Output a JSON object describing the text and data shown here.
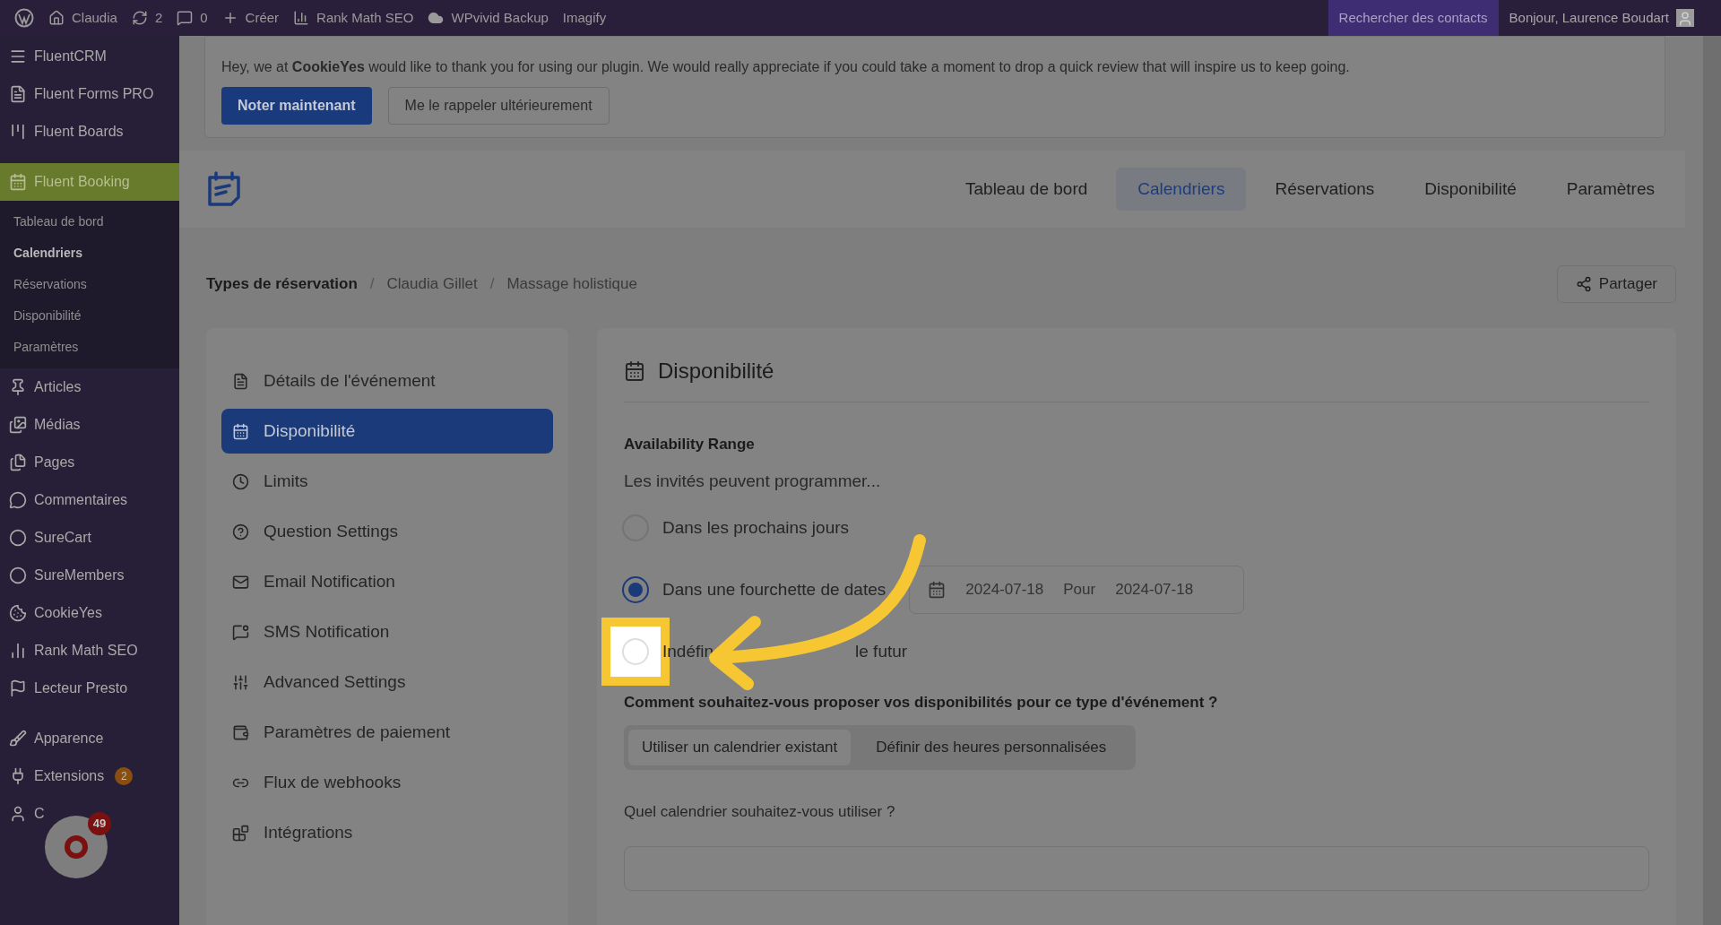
{
  "admin_bar": {
    "left": [
      {
        "kind": "wp"
      },
      {
        "kind": "home",
        "label": "Claudia"
      },
      {
        "kind": "updates",
        "label": "2"
      },
      {
        "kind": "comments",
        "label": "0"
      },
      {
        "kind": "new",
        "label": "Créer"
      },
      {
        "kind": "rankmath",
        "label": "Rank Math SEO"
      },
      {
        "kind": "cloud",
        "label": "WPvivid Backup"
      },
      {
        "kind": "text",
        "label": "Imagify"
      }
    ],
    "search": "Rechercher des contacts",
    "greeting": "Bonjour, Laurence Boudart"
  },
  "sidebar": {
    "items": [
      {
        "label": "FluentCRM",
        "selected": false
      },
      {
        "label": "Fluent Forms PRO",
        "selected": false
      },
      {
        "label": "Fluent Boards",
        "selected": false
      },
      {
        "label": "Fluent Booking",
        "selected": true,
        "children": [
          {
            "label": "Tableau de bord",
            "selected": false
          },
          {
            "label": "Calendriers",
            "selected": true
          },
          {
            "label": "Réservations",
            "selected": false
          },
          {
            "label": "Disponibilité",
            "selected": false
          },
          {
            "label": "Paramètres",
            "selected": false
          }
        ]
      },
      {
        "label": "Articles",
        "selected": false
      },
      {
        "label": "Médias",
        "selected": false
      },
      {
        "label": "Pages",
        "selected": false
      },
      {
        "label": "Commentaires",
        "selected": false
      },
      {
        "label": "SureCart",
        "selected": false
      },
      {
        "label": "SureMembers",
        "selected": false
      },
      {
        "label": "CookieYes",
        "selected": false
      },
      {
        "label": "Rank Math SEO",
        "selected": false
      },
      {
        "label": "Lecteur Presto",
        "selected": false
      },
      {
        "label": "Apparence",
        "selected": false
      },
      {
        "label": "Extensions",
        "selected": false,
        "badge": "2"
      },
      {
        "label": "C",
        "selected": false
      }
    ],
    "widget_badge": "49"
  },
  "notice": {
    "text": "Hey, we at **CookieYes** would like to thank you for using our plugin. We would really appreciate if you could take a moment to drop a quick review that will inspire us to keep going.",
    "buttons": [
      "Noter maintenant",
      "Me le rappeler ultérieurement"
    ]
  },
  "nav": {
    "tabs": [
      {
        "label": "Tableau de bord",
        "selected": false
      },
      {
        "label": "Calendriers",
        "selected": true
      },
      {
        "label": "Réservations",
        "selected": false
      },
      {
        "label": "Disponibilité",
        "selected": false
      },
      {
        "label": "Paramètres",
        "selected": false
      }
    ]
  },
  "breadcrumb": [
    {
      "kind": "link",
      "label": "Types de réservation"
    },
    {
      "kind": "separator",
      "label": "/"
    },
    {
      "kind": "link",
      "label": "Claudia Gillet"
    },
    {
      "kind": "separator",
      "label": "/"
    },
    {
      "kind": "link",
      "label": "Massage holistique"
    }
  ],
  "share_button": "Partager",
  "settings_menu": [
    {
      "label": "Détails de l'événement",
      "selected": false
    },
    {
      "label": "Disponibilité",
      "selected": true
    },
    {
      "label": "Limits",
      "selected": false
    },
    {
      "label": "Question Settings",
      "selected": false
    },
    {
      "label": "Email Notification",
      "selected": false
    },
    {
      "label": "SMS Notification",
      "selected": false
    },
    {
      "label": "Advanced Settings",
      "selected": false
    },
    {
      "label": "Paramètres de paiement",
      "selected": false
    },
    {
      "label": "Flux de webhooks",
      "selected": false
    },
    {
      "label": "Intégrations",
      "selected": false
    }
  ],
  "panel": {
    "title": "Disponibilité",
    "range_label": "Availability Range",
    "range_hint": "Les invités peuvent programmer...",
    "options": [
      {
        "label": [
          "Dans les prochains jours"
        ],
        "selected": false,
        "highlighted": false
      },
      {
        "label": [
          "Dans une fourchette de dates"
        ],
        "selected": true,
        "highlighted": false,
        "date_from": "2024-07-18",
        "date_sep": "Pour",
        "date_to": "2024-07-18"
      },
      {
        "label": [
          "Indéfin",
          "le futur"
        ],
        "selected": false,
        "highlighted": true
      }
    ],
    "question": "Comment souhaitez-vous proposer vos disponibilités pour ce type d'événement ?",
    "segments": [
      {
        "label": "Utiliser un calendrier existant",
        "selected": true
      },
      {
        "label": "Définir des heures personnalisées",
        "selected": false
      }
    ],
    "calendar_question": "Quel calendrier souhaitez-vous utiliser ?"
  }
}
